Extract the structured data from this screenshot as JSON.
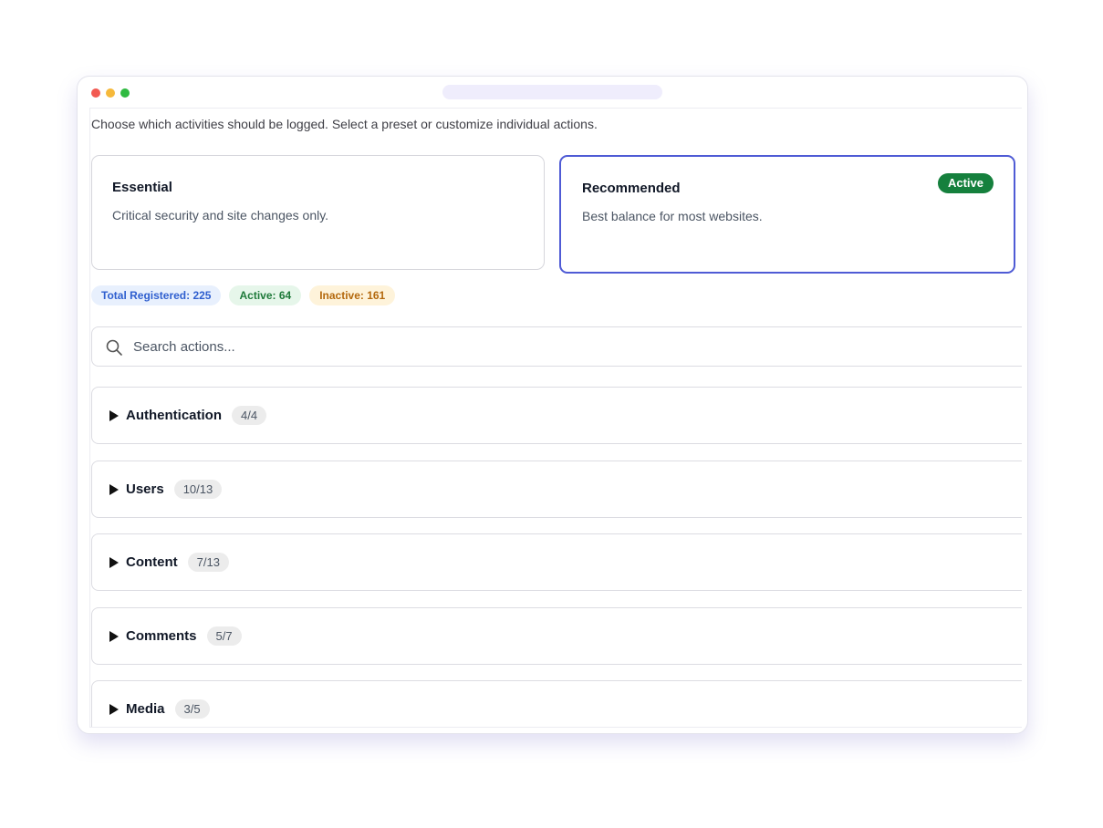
{
  "intro": "Choose which activities should be logged. Select a preset or customize individual actions.",
  "presets": [
    {
      "title": "Essential",
      "description": "Critical security and site changes only.",
      "active": false
    },
    {
      "title": "Recommended",
      "description": "Best balance for most websites.",
      "active": true,
      "badge": "Active"
    }
  ],
  "stats": {
    "total": "Total Registered: 225",
    "active": "Active: 64",
    "inactive": "Inactive: 161"
  },
  "search": {
    "placeholder": "Search actions...",
    "icon": "search-icon"
  },
  "groups": [
    {
      "name": "Authentication",
      "count": "4/4"
    },
    {
      "name": "Users",
      "count": "10/13"
    },
    {
      "name": "Content",
      "count": "7/13"
    },
    {
      "name": "Comments",
      "count": "5/7"
    },
    {
      "name": "Media",
      "count": "3/5"
    }
  ],
  "colors": {
    "accent": "#4f5bd5",
    "active_badge": "#15803d"
  }
}
